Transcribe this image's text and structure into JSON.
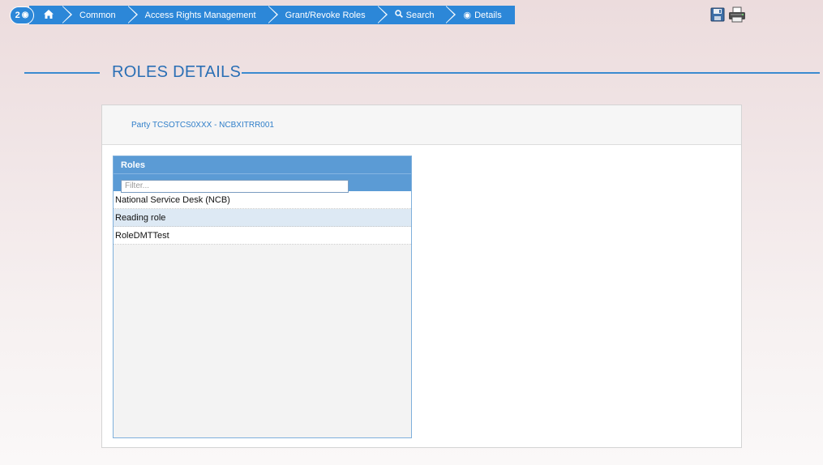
{
  "breadcrumb": {
    "counter": "2",
    "items": [
      {
        "label": "Common"
      },
      {
        "label": "Access Rights Management"
      },
      {
        "label": "Grant/Revoke Roles"
      },
      {
        "label": "Search"
      },
      {
        "label": "Details"
      }
    ]
  },
  "tools": {
    "icons": [
      "save-icon",
      "print-icon"
    ]
  },
  "page": {
    "title": "ROLES DETAILS"
  },
  "panel": {
    "party_label": "Party TCSOTCS0XXX - NCBXITRR001"
  },
  "roles": {
    "header": "Roles",
    "filter_placeholder": "Filter...",
    "items": [
      {
        "label": "National Service Desk (NCB)",
        "selected": false
      },
      {
        "label": "Reading role",
        "selected": true
      },
      {
        "label": "RoleDMTTest",
        "selected": false
      }
    ]
  },
  "colors": {
    "accent": "#2c87d8",
    "title": "#2a6fb5",
    "roles_header": "#5b9bd5",
    "selected_row": "#dde9f4"
  }
}
